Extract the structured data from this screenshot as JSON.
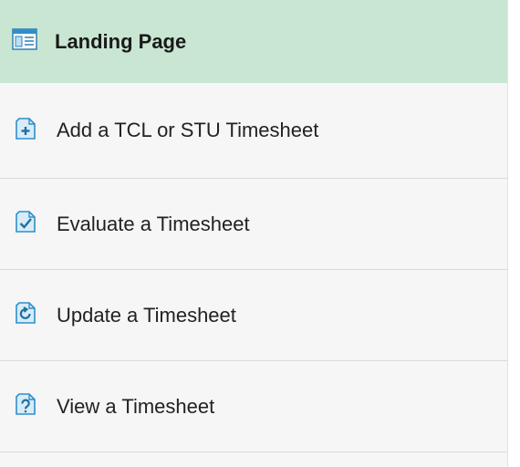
{
  "header": {
    "title": "Landing Page",
    "icon": "landing-page-icon",
    "background": "#c9e6d3"
  },
  "items": [
    {
      "label": "Add a TCL or STU Timesheet",
      "icon": "add-document-icon"
    },
    {
      "label": "Evaluate a Timesheet",
      "icon": "checkmark-document-icon"
    },
    {
      "label": "Update a Timesheet",
      "icon": "update-document-icon"
    },
    {
      "label": "View a Timesheet",
      "icon": "view-document-icon"
    }
  ],
  "colors": {
    "icon_accent": "#2f8fc9",
    "icon_fill": "#d7ecf8"
  }
}
